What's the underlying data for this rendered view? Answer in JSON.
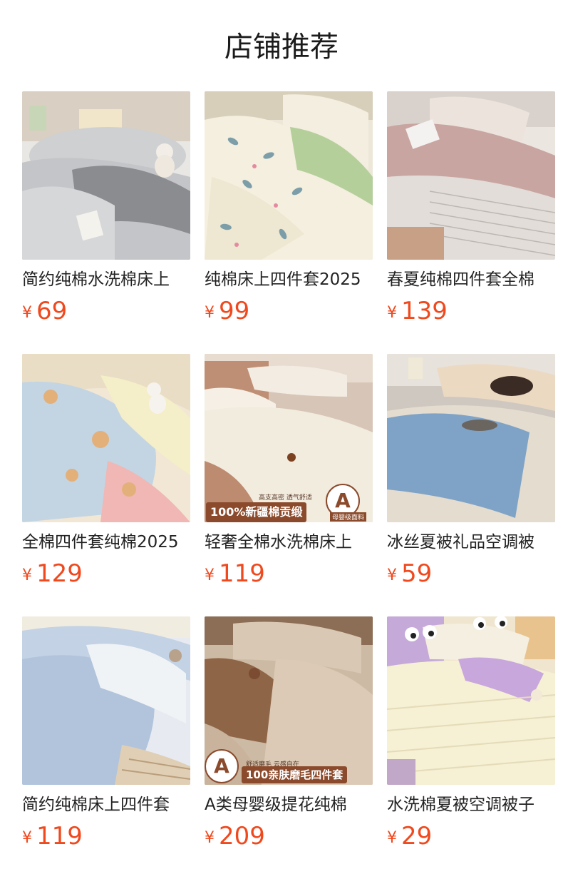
{
  "page": {
    "title": "店铺推荐"
  },
  "currency": "¥",
  "products": [
    {
      "name": "简约纯棉水洗棉床上",
      "price": "69"
    },
    {
      "name": "纯棉床上四件套2025",
      "price": "99"
    },
    {
      "name": "春夏纯棉四件套全棉",
      "price": "139"
    },
    {
      "name": "全棉四件套纯棉2025",
      "price": "129"
    },
    {
      "name": "轻奢全棉水洗棉床上",
      "price": "119",
      "badge": {
        "main": "100%新疆棉贡缎",
        "sub": "高支高密 透气舒适",
        "letter": "A",
        "letter_sub": "母婴级面料"
      }
    },
    {
      "name": "冰丝夏被礼品空调被",
      "price": "59"
    },
    {
      "name": "简约纯棉床上四件套",
      "price": "119"
    },
    {
      "name": "A类母婴级提花纯棉",
      "price": "209",
      "badge": {
        "main": "100亲肤磨毛四件套",
        "sub": "舒适磨毛 云感自在",
        "letter": "A"
      }
    },
    {
      "name": "水洗棉夏被空调被子",
      "price": "29"
    }
  ],
  "images": [
    "grey-bedding-with-teddy-bear-photo",
    "leaf-print-green-bedding-photo",
    "pink-striped-bedding-photo",
    "bear-cartoon-blue-bedding-photo",
    "cream-satin-bedding-photo",
    "blue-silk-summer-quilt-photo",
    "light-blue-bedding-photo",
    "brown-jacquard-bedding-photo",
    "pastel-summer-quilt-photo"
  ],
  "colors": {
    "price": "#f0491e",
    "title": "#1b1b1b"
  }
}
